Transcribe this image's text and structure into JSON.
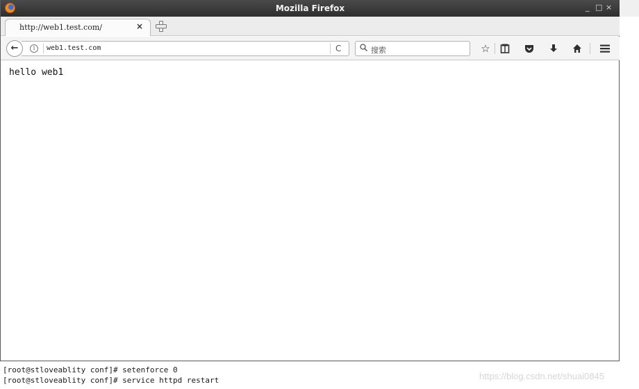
{
  "window": {
    "title": "Mozilla Firefox",
    "controls": {
      "minimize": "_",
      "maximize": "□",
      "close": "×"
    }
  },
  "tabs": [
    {
      "label": "http://web1.test.com/",
      "close": "×"
    }
  ],
  "navbar": {
    "back_icon": "←",
    "info_icon": "i",
    "url": "web1.test.com",
    "reload_icon": "C",
    "search_icon": "🔍",
    "search_placeholder": "搜索",
    "toolbar_icons": [
      "bookmark-star-icon",
      "reading-list-icon",
      "pocket-icon",
      "download-icon",
      "home-icon",
      "menu-icon"
    ]
  },
  "page": {
    "body_text": "hello web1"
  },
  "terminal": {
    "lines": [
      "[root@stloveablity conf]# setenforce 0",
      "[root@stloveablity conf]# service httpd restart"
    ]
  },
  "watermark": "https://blog.csdn.net/shuai0845"
}
